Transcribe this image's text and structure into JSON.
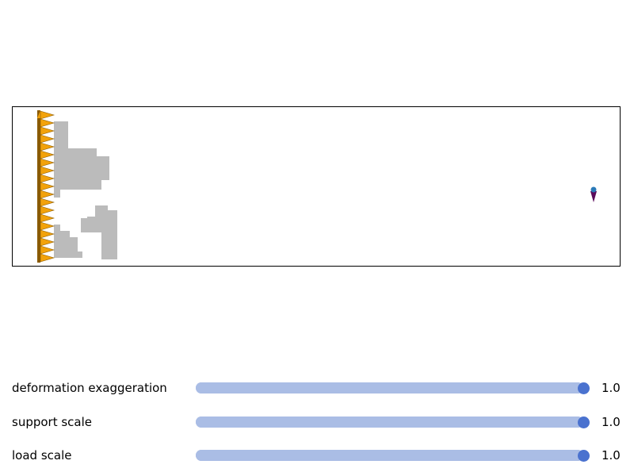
{
  "colors": {
    "material": "#bbbbbb",
    "support": "#f2a20b",
    "support_dark": "#8a5a00",
    "load_arrow": "#5a0a5a",
    "load_point": "#2a7ab8",
    "slider_track": "#aabde5",
    "slider_knob": "#4a72cf",
    "frame": "#000000"
  },
  "viewport": {
    "icons": [
      "fixed-support-icon",
      "point-load-icon"
    ],
    "support_count": 19
  },
  "sliders": [
    {
      "label": "deformation exaggeration",
      "value": "1.0",
      "fraction": 1.0
    },
    {
      "label": "support scale",
      "value": "1.0",
      "fraction": 1.0
    },
    {
      "label": "load scale",
      "value": "1.0",
      "fraction": 1.0
    }
  ]
}
